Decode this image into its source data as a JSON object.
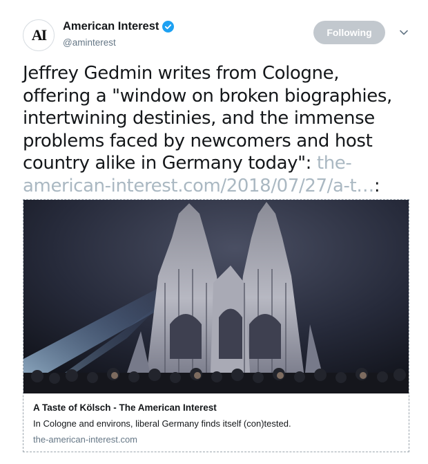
{
  "account": {
    "display_name": "American Interest",
    "handle": "@aminterest",
    "avatar_text": "AI",
    "verified": true
  },
  "actions": {
    "follow_label": "Following"
  },
  "tweet": {
    "text": "Jeffrey Gedmin writes from Cologne, offering a \"window on broken biographies, intertwining destinies, and the immense problems faced by newcomers and host country alike in Germany today\": ",
    "link": "the-american-interest.com/2018/07/27/a-t…",
    "trailing": ":"
  },
  "card": {
    "title": "A Taste of Kölsch - The American Interest",
    "description": "In Cologne and environs, liberal Germany finds itself (con)tested.",
    "domain": "the-american-interest.com"
  },
  "colors": {
    "verified": "#1da1f2",
    "button": "#c2c8ce",
    "link": "#aab8c2",
    "secondary_text": "#657786"
  },
  "icons": {
    "verified": "verified-badge-icon",
    "more": "chevron-down-icon"
  }
}
